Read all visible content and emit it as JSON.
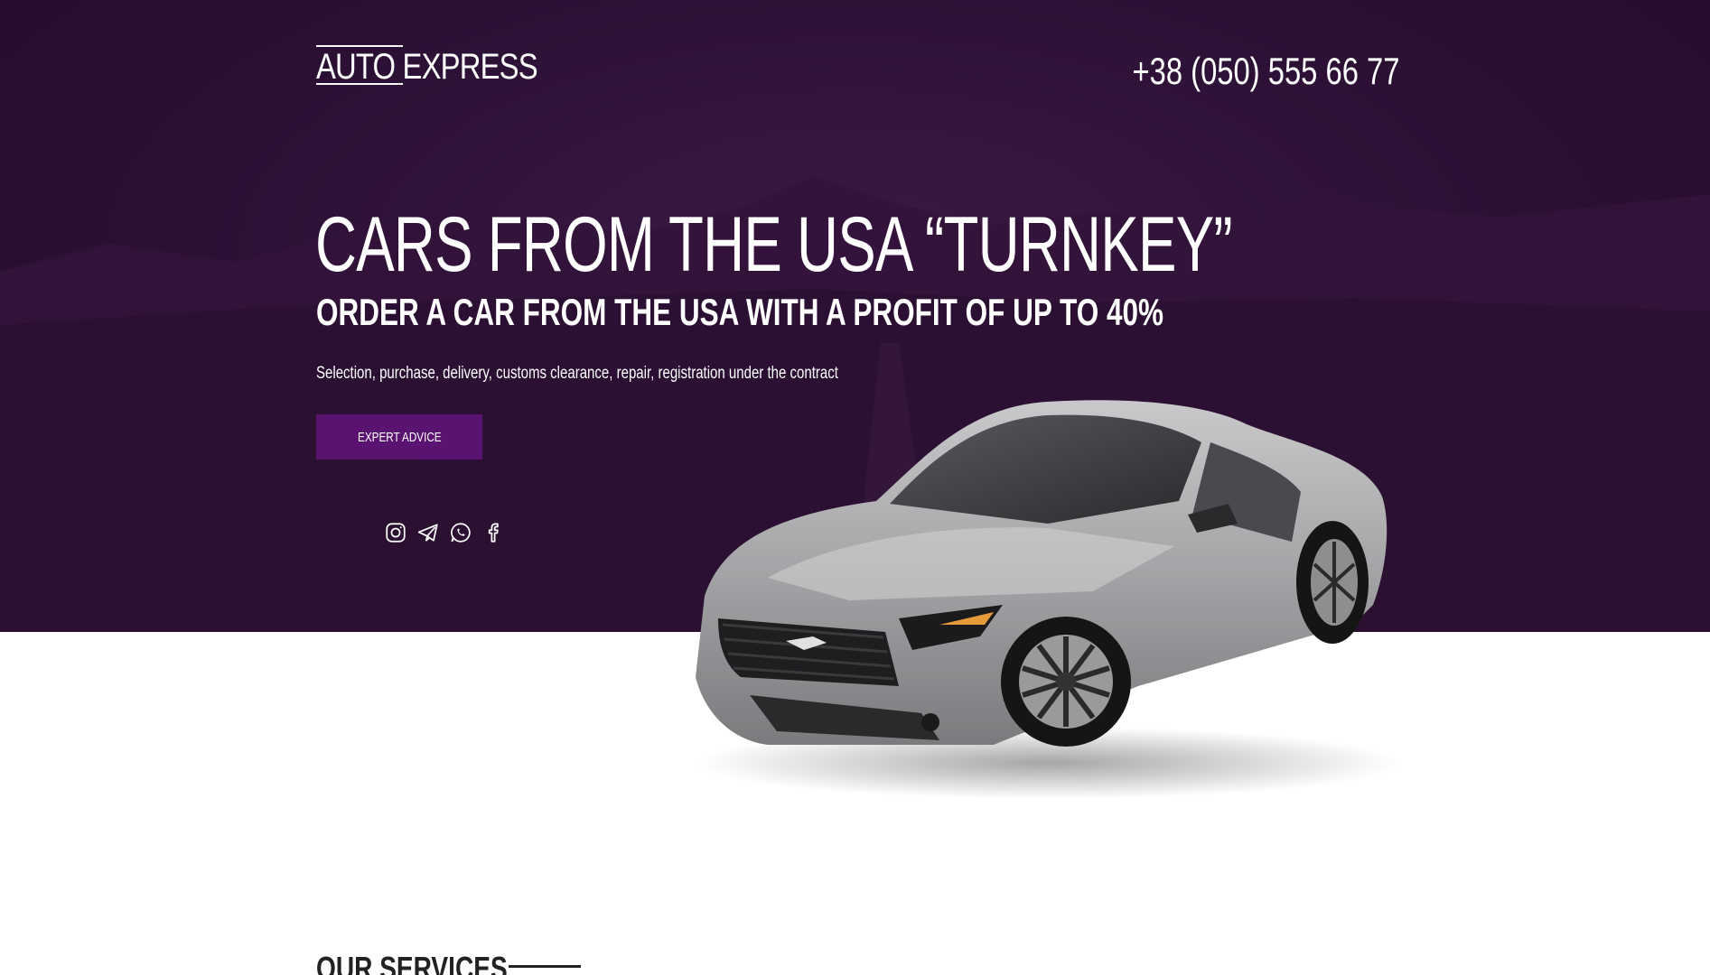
{
  "header": {
    "logo_part1": "AUTO ",
    "logo_part2": "EXPRESS",
    "phone": "+38 (050) 555 66 77"
  },
  "hero": {
    "headline": "CARS FROM THE USA “TURNKEY”",
    "subheadline": "ORDER A CAR FROM THE USA WITH A PROFIT OF UP TO 40%",
    "description": "Selection, purchase, delivery, customs clearance, repair, registration under the contract",
    "cta_label": "EXPERT ADVICE",
    "socials": [
      "instagram-icon",
      "telegram-icon",
      "whatsapp-icon",
      "facebook-icon"
    ]
  },
  "services": {
    "title": "OUR SERVICES"
  },
  "colors": {
    "hero_background": "#2c1034",
    "accent": "#5a1370",
    "text_light": "#ffffff",
    "text_dark": "#222222"
  }
}
